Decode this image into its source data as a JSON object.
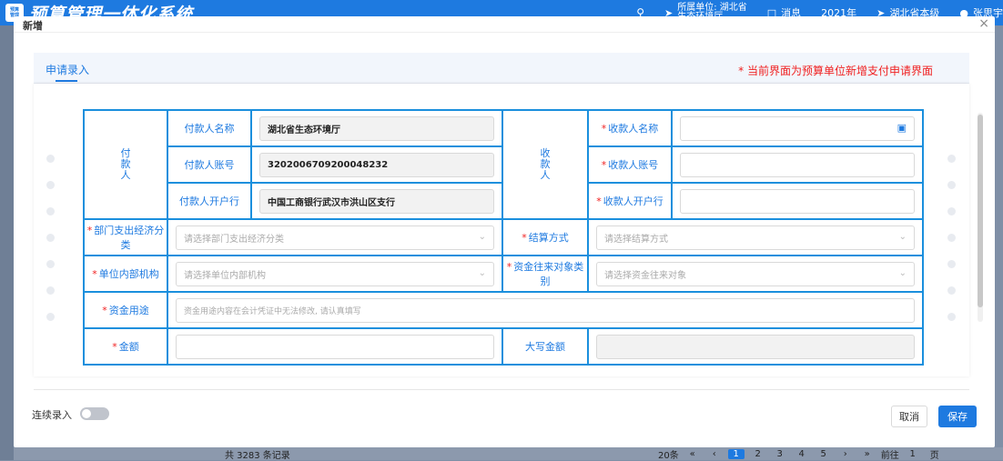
{
  "app": {
    "logo_text": "预算管理",
    "title": "预算管理一体化系统"
  },
  "topbar": {
    "search_icon": "search-icon",
    "unit_line1": "所属单位: 湖北省",
    "unit_line2": "生态环境厅",
    "messages": "消息",
    "year": "2021年",
    "region": "湖北省本级",
    "user": "张思宇"
  },
  "dialog": {
    "title": "新增",
    "close": "×",
    "section_tab": "申请录入",
    "hint": "* 当前界面为预算单位新增支付申请界面"
  },
  "form": {
    "payer_group": [
      "付",
      "款",
      "人"
    ],
    "payee_group": [
      "收",
      "款",
      "人"
    ],
    "payer_name_label": "付款人名称",
    "payer_name_value": "湖北省生态环境厅",
    "payer_account_label": "付款人账号",
    "payer_account_value": "3202006709200048232",
    "payer_bank_label": "付款人开户行",
    "payer_bank_value": "中国工商银行武汉市洪山区支行",
    "payee_name_label": "收款人名称",
    "payee_account_label": "收款人账号",
    "payee_bank_label": "收款人开户行",
    "econ_class_label": "部门支出经济分类",
    "econ_class_placeholder": "请选择部门支出经济分类",
    "settle_label": "结算方式",
    "settle_placeholder": "请选择结算方式",
    "inner_org_label": "单位内部机构",
    "inner_org_placeholder": "请选择单位内部机构",
    "counterparty_label": "资金往来对象类别",
    "counterparty_placeholder": "请选择资金往来对象",
    "purpose_label": "资金用途",
    "purpose_placeholder": "资金用途内容在会计凭证中无法修改, 请认真填写",
    "amount_label": "金额",
    "capital_amount_label": "大写金额"
  },
  "footer": {
    "continuous_label": "连续录入",
    "cancel": "取消",
    "save": "保存"
  },
  "background": {
    "total": "共 3283 条记录",
    "page_size": "20条",
    "pages": [
      "«",
      "‹",
      "1",
      "2",
      "3",
      "4",
      "5",
      "›",
      "»"
    ],
    "goto_label": "前往",
    "goto_value": "1",
    "page_unit": "页"
  }
}
